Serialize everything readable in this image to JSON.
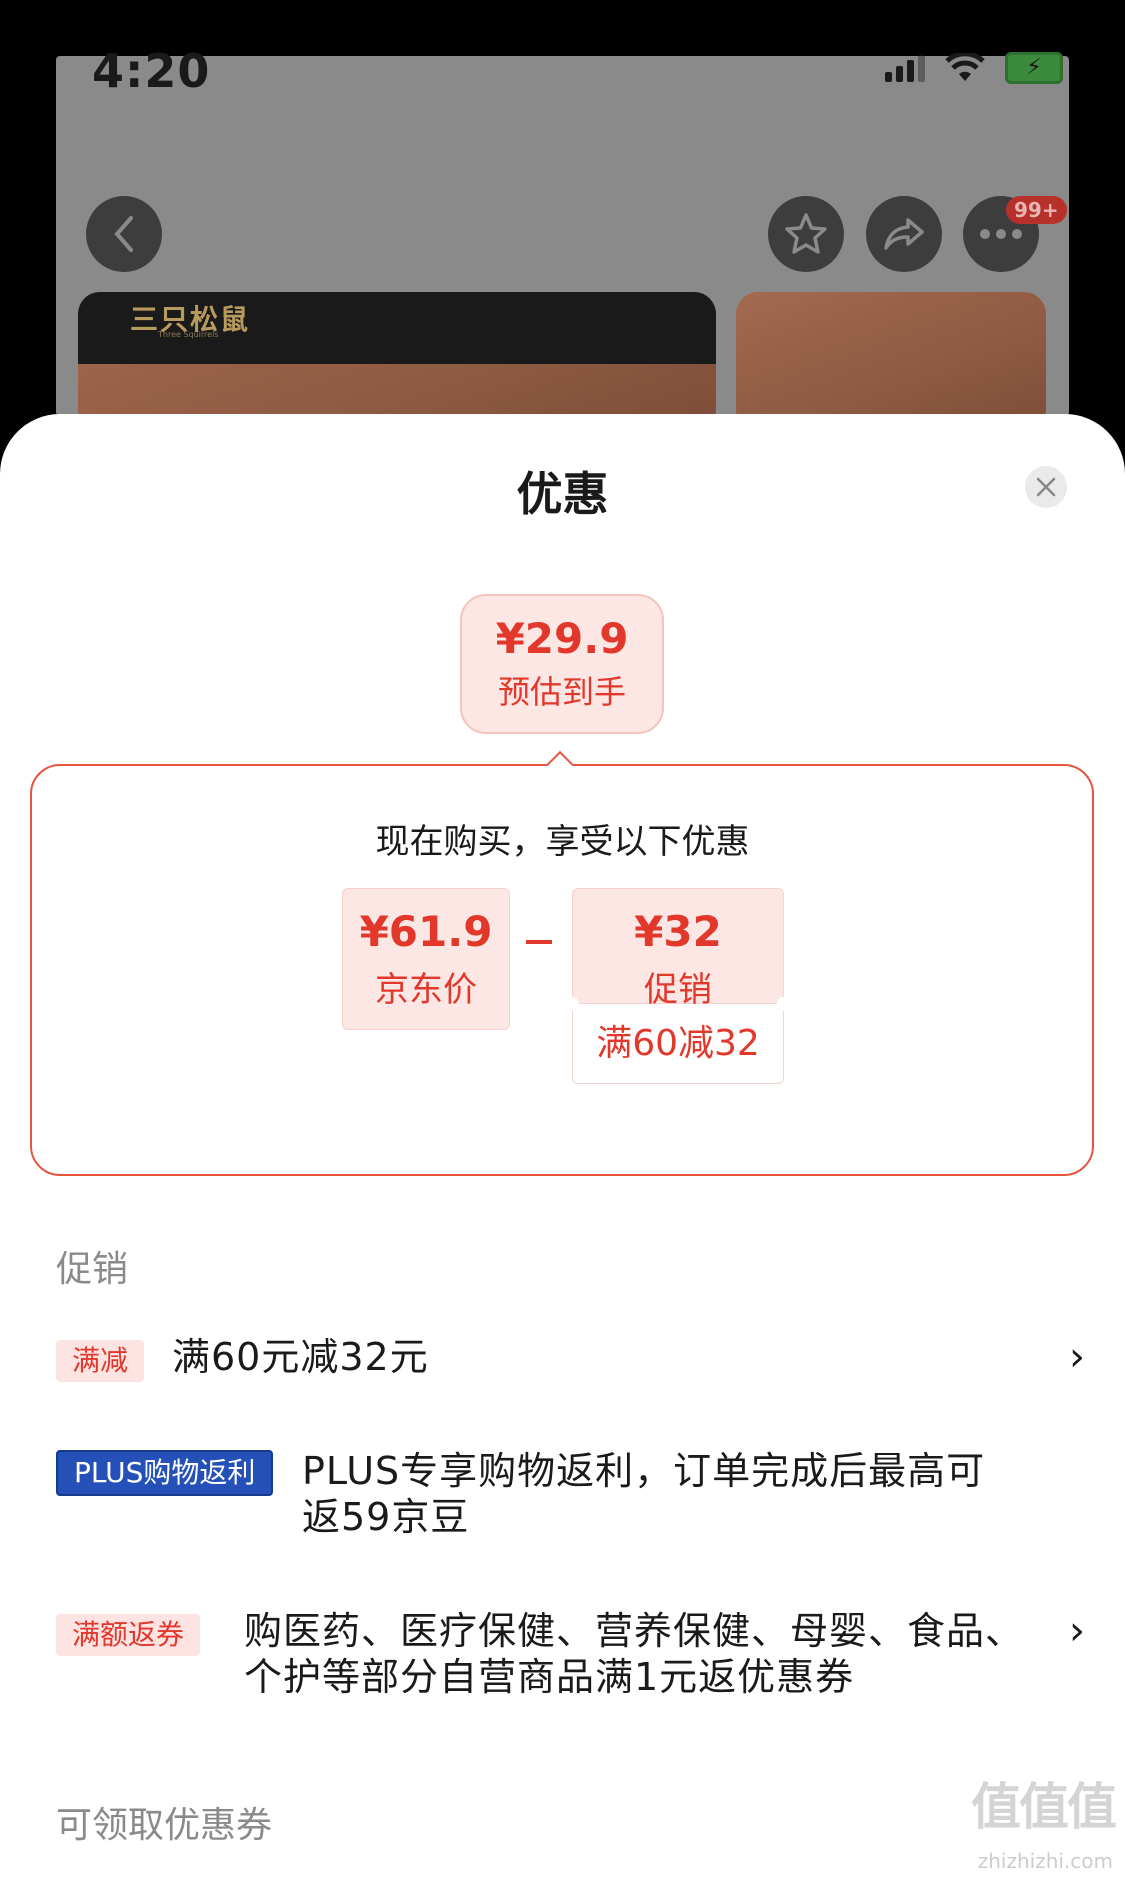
{
  "status_bar": {
    "time": "4:20"
  },
  "background_app": {
    "brand_logo": "三只松鼠",
    "brand_sub": "Three Squirrels",
    "more_badge": "99+",
    "icons": [
      "back-icon",
      "favorite-star-icon",
      "share-icon",
      "more-icon"
    ]
  },
  "sheet": {
    "title": "优惠",
    "estimate": {
      "price": "¥29.9",
      "label": "预估到手"
    },
    "deal": {
      "heading": "现在购买，享受以下优惠",
      "jd_price": "¥61.9",
      "jd_price_label": "京东价",
      "promo_price": "¥32",
      "promo_label": "促销",
      "condition": "满60减32"
    },
    "promotions": {
      "title": "促销",
      "items": [
        {
          "tag": "满减",
          "text": "满60元减32元"
        },
        {
          "tag": "PLUS购物返利",
          "text_line1": "PLUS专享购物返利，订单完成后最高可",
          "text_line2": "返59京豆"
        },
        {
          "tag": "满额返券",
          "text_line1": "购医药、医疗保健、营养保健、母婴、食品、",
          "text_line2": "个护等部分自营商品满1元返优惠券"
        }
      ]
    },
    "coupons": {
      "title": "可领取优惠券"
    }
  },
  "watermark": {
    "text": "值值值",
    "url": "zhizhizhi.com"
  },
  "colors": {
    "accent_red": "#e2382b",
    "plus_blue": "#2450b8"
  }
}
